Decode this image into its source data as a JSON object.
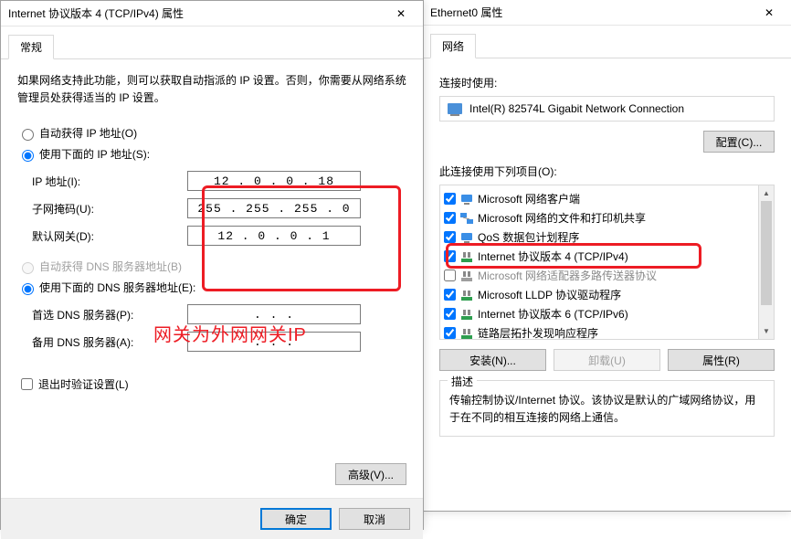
{
  "fg": {
    "title": "Internet 协议版本 4 (TCP/IPv4) 属性",
    "tab": "常规",
    "desc": "如果网络支持此功能，则可以获取自动指派的 IP 设置。否则，你需要从网络系统管理员处获得适当的 IP 设置。",
    "radio_auto_ip": "自动获得 IP 地址(O)",
    "radio_use_ip": "使用下面的 IP 地址(S):",
    "ip_label": "IP 地址(I):",
    "ip_value": "12 .  0 .  0 . 18",
    "mask_label": "子网掩码(U):",
    "mask_value": "255 . 255 . 255 .  0",
    "gw_label": "默认网关(D):",
    "gw_value": "12 .  0 .  0 .  1",
    "radio_auto_dns": "自动获得 DNS 服务器地址(B)",
    "radio_use_dns": "使用下面的 DNS 服务器地址(E):",
    "dns1_label": "首选 DNS 服务器(P):",
    "dns1_value": ".       .       .",
    "dns2_label": "备用 DNS 服务器(A):",
    "dns2_value": ".       .       .",
    "chk_validate": "退出时验证设置(L)",
    "btn_adv": "高级(V)...",
    "btn_ok": "确定",
    "btn_cancel": "取消"
  },
  "bg": {
    "title": "Ethernet0 属性",
    "tab": "网络",
    "conn_label": "连接时使用:",
    "nic": "Intel(R) 82574L Gigabit Network Connection",
    "btn_config": "配置(C)...",
    "list_label": "此连接使用下列项目(O):",
    "items": [
      "Microsoft 网络客户端",
      "Microsoft 网络的文件和打印机共享",
      "QoS 数据包计划程序",
      "Internet 协议版本 4 (TCP/IPv4)",
      "Microsoft 网络适配器多路传送器协议",
      "Microsoft LLDP 协议驱动程序",
      "Internet 协议版本 6 (TCP/IPv6)",
      "链路层拓扑发现响应程序"
    ],
    "btn_install": "安装(N)...",
    "btn_uninstall": "卸载(U)",
    "btn_props": "属性(R)",
    "desc_legend": "描述",
    "desc_text": "传输控制协议/Internet 协议。该协议是默认的广域网络协议，用于在不同的相互连接的网络上通信。"
  },
  "annot": "网关为外网网关IP",
  "icons": {
    "client": "#3a8ee6",
    "net": "#2e9e4f"
  }
}
